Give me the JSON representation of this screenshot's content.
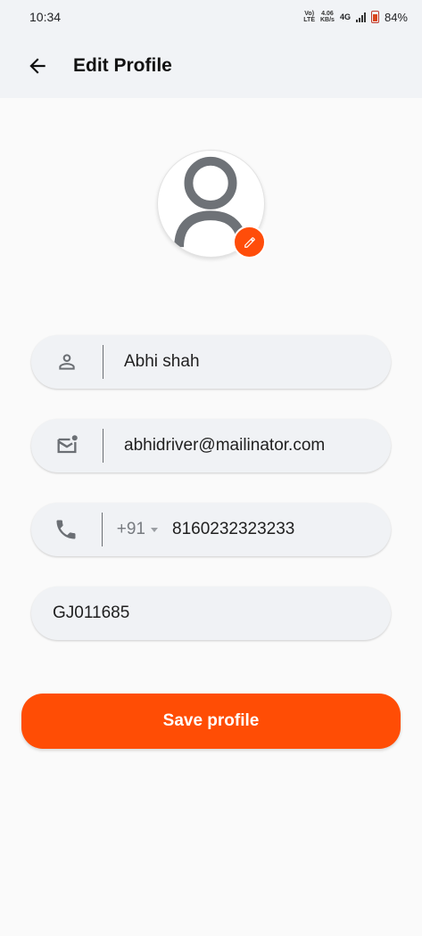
{
  "status_bar": {
    "time": "10:34",
    "volte_top": "Vo)",
    "volte_bottom": "LTE",
    "speed_top": "4.06",
    "speed_bottom": "KB/s",
    "network": "4G",
    "battery": "84%"
  },
  "header": {
    "title": "Edit Profile",
    "back_icon": "arrow-left-icon"
  },
  "profile": {
    "avatar_icon": "person-placeholder-icon",
    "edit_icon": "pencil-icon"
  },
  "form": {
    "name": {
      "value": "Abhi shah",
      "icon": "person-outline-icon"
    },
    "email": {
      "value": "abhidriver@mailinator.com",
      "icon": "mail-unread-icon"
    },
    "phone": {
      "country_code": "+91",
      "value": "8160232323233",
      "icon": "phone-icon"
    },
    "vehicle": {
      "value": "GJ011685"
    }
  },
  "actions": {
    "save_label": "Save profile"
  },
  "colors": {
    "accent": "#ff4d05",
    "header_bg": "#f1f3f6",
    "field_bg": "#f0f2f5",
    "icon_gray": "#6b6f74"
  }
}
